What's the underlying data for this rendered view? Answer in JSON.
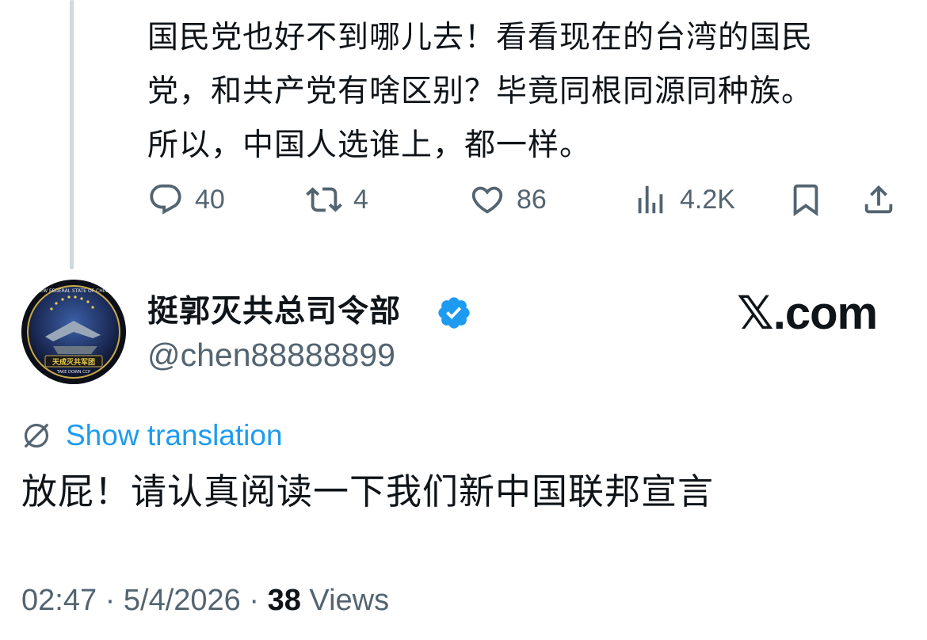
{
  "parent_tweet": {
    "text_lines": [
      "国民党也好不到哪儿去！看看现在的台湾的国民",
      "党，和共产党有啥区别？毕竟同根同源同种族。",
      "所以，中国人选谁上，都一样。"
    ],
    "replies": "40",
    "reposts": "4",
    "likes": "86",
    "views": "4.2K"
  },
  "tweet": {
    "display_name": "挺郭灭共总司令部",
    "handle": "@chen88888899",
    "verified": true,
    "watermark": "𝕏.com",
    "show_translation": "Show translation",
    "text": "放屁！请认真阅读一下我们新中国联邦宣言",
    "time": "02:47",
    "date": "5/4/2026",
    "views_count": "38",
    "views_label": "Views",
    "separator": "·"
  },
  "avatar_logo_text": [
    "NEW FEDERAL STATE OF CHINA",
    "天成灭共军团",
    "TAKE DOWN CCP"
  ],
  "colors": {
    "accent": "#1d9bf0",
    "secondary_text": "#536471",
    "primary_text": "#0f1419",
    "thread_line": "#cfd9de"
  },
  "icons": {
    "reply": "reply-icon",
    "repost": "repost-icon",
    "like": "heart-icon",
    "views": "analytics-icon",
    "bookmark": "bookmark-icon",
    "share": "share-icon",
    "verified": "verified-badge-icon",
    "translate": "globe-icon"
  }
}
